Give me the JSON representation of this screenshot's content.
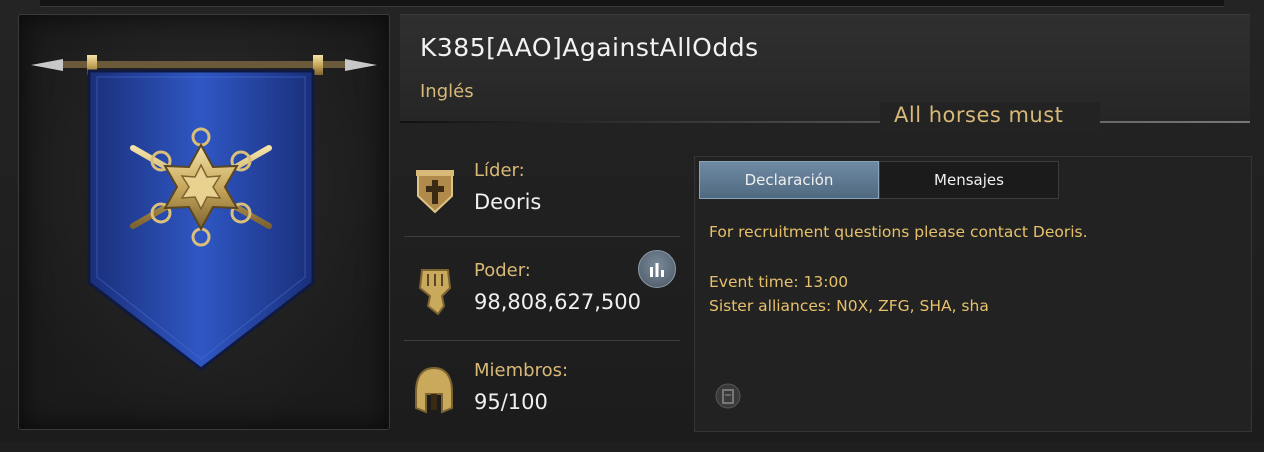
{
  "alliance": {
    "name": "K385[AAO]AgainstAllOdds",
    "language": "Inglés",
    "motto": "All horses must"
  },
  "stats": {
    "leader_label": "Líder:",
    "leader_value": "Deoris",
    "power_label": "Poder:",
    "power_value": "98,808,627,500",
    "members_label": "Miembros:",
    "members_value": "95/100"
  },
  "tabs": {
    "declaration": "Declaración",
    "messages": "Mensajes"
  },
  "declaration": {
    "line1": "For recruitment questions please contact Deoris.",
    "line2": "Event time: 13:00",
    "line3": "Sister alliances: N0X, ZFG, SHA, sha"
  },
  "colors": {
    "gold_text": "#d8b977",
    "banner_blue": "#2b4fb0",
    "tab_active": "#5f7b94"
  },
  "icons": [
    "banner-emblem-icon",
    "leader-badge-icon",
    "power-fist-icon",
    "members-helmet-icon",
    "chart-icon",
    "edit-icon"
  ]
}
